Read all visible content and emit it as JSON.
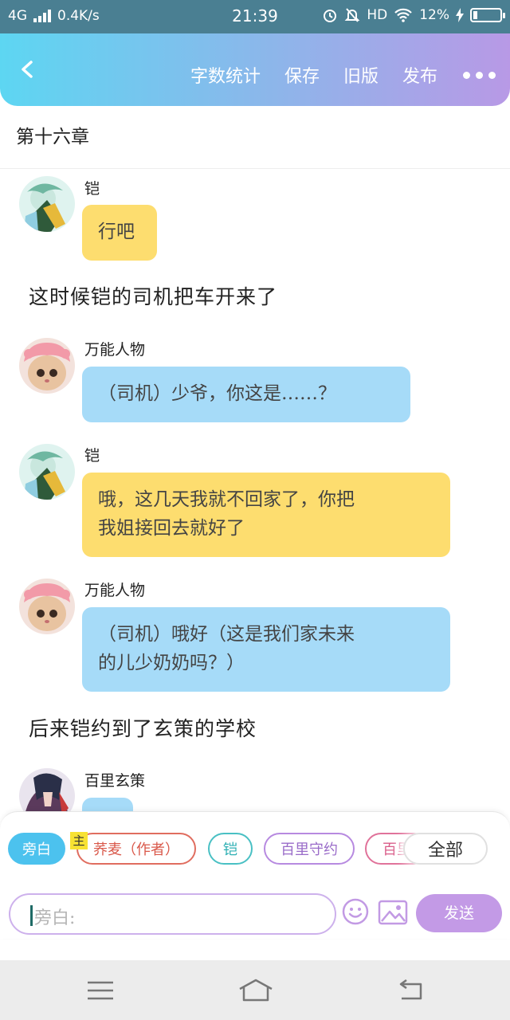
{
  "status_bar": {
    "network": "4G",
    "speed": "0.4K/s",
    "time": "21:39",
    "hd": "HD",
    "battery": "12%"
  },
  "toolbar": {
    "word_count": "字数统计",
    "save": "保存",
    "old_version": "旧版",
    "publish": "发布"
  },
  "chapter_title": "第十六章",
  "messages": [
    {
      "speaker": "铠",
      "text": "行吧"
    },
    {
      "narration": "这时候铠的司机把车开来了"
    },
    {
      "speaker": "万能人物",
      "text": "（司机）少爷，你这是……？"
    },
    {
      "speaker": "铠",
      "text_line1": "哦，这几天我就不回家了，你把",
      "text_line2": "我姐接回去就好了"
    },
    {
      "speaker": "万能人物",
      "text_line1": "（司机）哦好（这是我们家未来",
      "text_line2": "的儿少奶奶吗？）"
    },
    {
      "narration": "后来铠约到了玄策的学校"
    },
    {
      "speaker": "百里玄策"
    }
  ],
  "role_chips": [
    "旁白",
    "荞麦（作者）",
    "铠",
    "百里守约",
    "百里",
    "全部"
  ],
  "main_tag": "主",
  "input": {
    "placeholder": "旁白:"
  },
  "send_label": "发送",
  "colors": {
    "yellow_bubble": "#fddd6f",
    "blue_bubble": "#a6dbf8",
    "accent": "#c39ae6"
  }
}
